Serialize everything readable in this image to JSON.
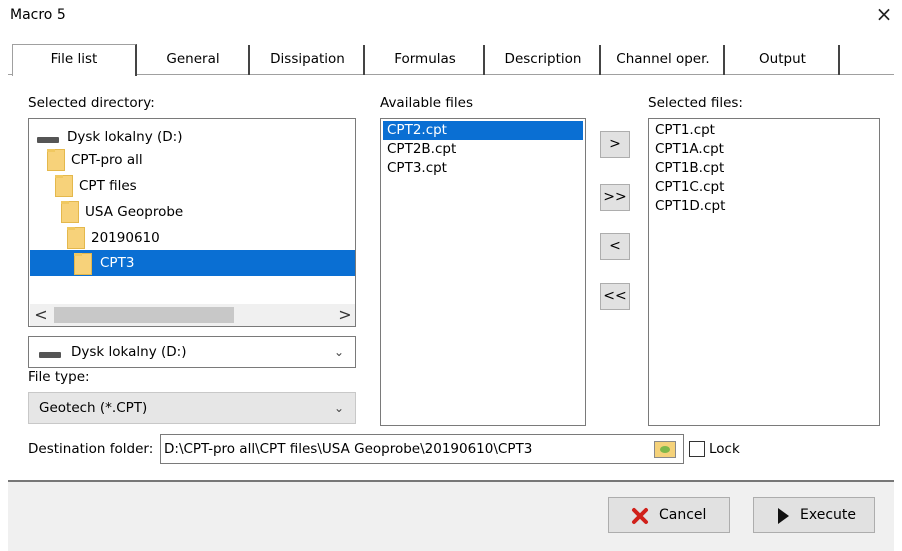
{
  "window": {
    "title": "Macro 5",
    "close_glyph": "×"
  },
  "tabs": [
    {
      "label": "File list",
      "active": true
    },
    {
      "label": "General"
    },
    {
      "label": "Dissipation"
    },
    {
      "label": "Formulas"
    },
    {
      "label": "Description"
    },
    {
      "label": "Channel oper."
    },
    {
      "label": "Output"
    }
  ],
  "directory": {
    "label": "Selected directory:",
    "tree": [
      {
        "label": "Dysk lokalny (D:)",
        "icon": "drive-icon"
      },
      {
        "label": "CPT-pro all",
        "icon": "folder-icon"
      },
      {
        "label": "CPT files",
        "icon": "folder-icon"
      },
      {
        "label": "USA Geoprobe",
        "icon": "folder-icon"
      },
      {
        "label": "20190610",
        "icon": "folder-icon"
      },
      {
        "label": "CPT3",
        "icon": "folder-icon",
        "selected": true
      }
    ],
    "scroll_left": "<",
    "scroll_right": ">",
    "drive_combo": "Dysk lokalny (D:)"
  },
  "file_type": {
    "label": "File type:",
    "value": "Geotech (*.CPT)"
  },
  "available": {
    "label": "Available files",
    "files": [
      "CPT2.cpt",
      "CPT2B.cpt",
      "CPT3.cpt"
    ],
    "selected_index": 0
  },
  "move_buttons": {
    "add": ">",
    "add_all": ">>",
    "remove": "<",
    "remove_all": "<<"
  },
  "selected": {
    "label": "Selected files:",
    "files": [
      "CPT1.cpt",
      "CPT1A.cpt",
      "CPT1B.cpt",
      "CPT1C.cpt",
      "CPT1D.cpt"
    ]
  },
  "destination": {
    "label": "Destination folder:",
    "value": "D:\\CPT-pro all\\CPT files\\USA Geoprobe\\20190610\\CPT3",
    "lock_label": "Lock"
  },
  "buttons": {
    "cancel": "Cancel",
    "execute": "Execute"
  },
  "colors": {
    "selection": "#0a6fd3",
    "cancel_icon": "#d0201a"
  }
}
